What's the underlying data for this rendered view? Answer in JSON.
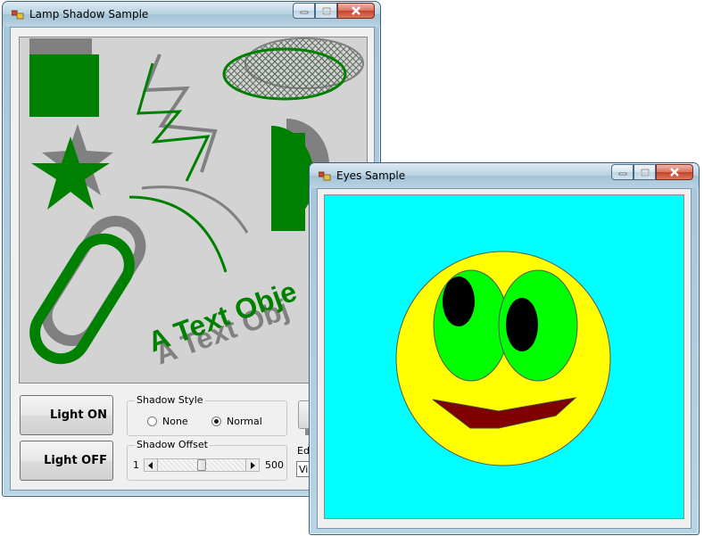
{
  "lamp_window": {
    "title": "Lamp Shadow Sample",
    "canvas_text": "A Text Obje",
    "shadow_text": "A Text Obj",
    "buttons": {
      "light_on": "Light ON",
      "light_off": "Light OFF"
    },
    "shadow_style": {
      "label": "Shadow Style",
      "options": [
        "None",
        "Normal"
      ],
      "selected": "Normal"
    },
    "shadow_offset": {
      "label": "Shadow Offset",
      "min": "1",
      "max": "500",
      "value_fraction": 0.48
    },
    "edit_label": "Ed",
    "view_field_value": "Vie",
    "colors": {
      "shape": "#008000",
      "shadow": "#808080",
      "canvas": "#d3d3d3"
    }
  },
  "eyes_window": {
    "title": "Eyes Sample",
    "colors": {
      "background": "#00ffff",
      "face": "#ffff00",
      "eyes": "#00ff00",
      "pupils": "#000000",
      "mouth": "#800000"
    }
  },
  "caption_icons": [
    "minimize-icon",
    "maximize-icon",
    "close-icon"
  ]
}
